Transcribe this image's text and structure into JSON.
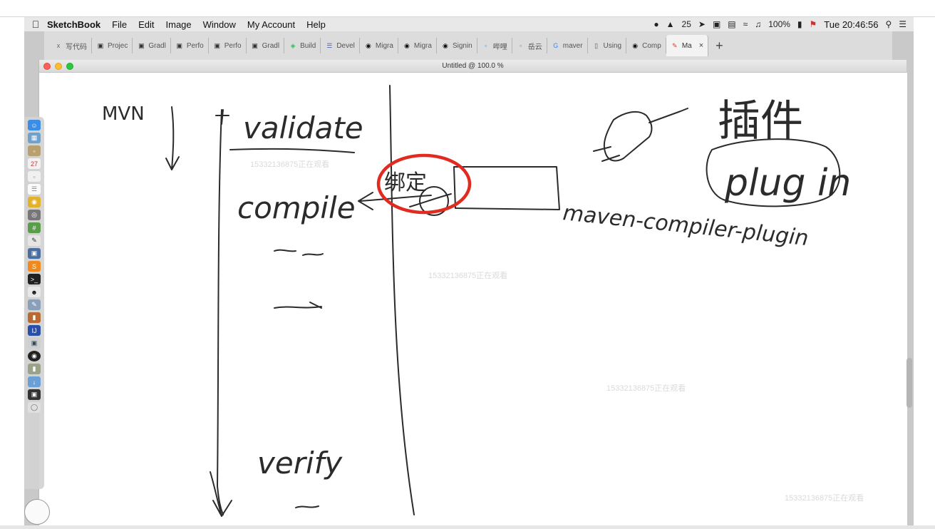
{
  "menubar": {
    "app_name": "SketchBook",
    "items": [
      "File",
      "Edit",
      "Image",
      "Window",
      "My Account",
      "Help"
    ],
    "status": {
      "notification_count": "25",
      "battery": "100%",
      "clock": "Tue 20:46:56"
    }
  },
  "browser": {
    "tabs": [
      {
        "label": "写代码",
        "icon": "xml-icon"
      },
      {
        "label": "Projec",
        "icon": "document-icon"
      },
      {
        "label": "Gradl",
        "icon": "document-icon"
      },
      {
        "label": "Perfo",
        "icon": "document-icon"
      },
      {
        "label": "Perfo",
        "icon": "document-icon"
      },
      {
        "label": "Gradl",
        "icon": "document-icon"
      },
      {
        "label": "Build",
        "icon": "elephant-icon"
      },
      {
        "label": "Devel",
        "icon": "list-icon"
      },
      {
        "label": "Migra",
        "icon": "github-icon"
      },
      {
        "label": "Migra",
        "icon": "github-icon"
      },
      {
        "label": "Signin",
        "icon": "github-icon"
      },
      {
        "label": "哔哩",
        "icon": "bilibili-icon"
      },
      {
        "label": "岳云",
        "icon": "bilibili-icon"
      },
      {
        "label": "maver",
        "icon": "google-icon"
      },
      {
        "label": "Using",
        "icon": "book-icon"
      },
      {
        "label": "Comp",
        "icon": "github-icon"
      },
      {
        "label": "Ma",
        "icon": "pencil-icon",
        "active": true
      }
    ],
    "new_tab": "+"
  },
  "window": {
    "title": "Untitled @ 100.0 %"
  },
  "watermark_text": "15332136875正在观看",
  "sketch": {
    "lifecycle_label": "MVN",
    "phases": [
      "validate",
      "compile",
      "verify"
    ],
    "binding_label": "绑定",
    "plugin_cn": "插件",
    "plugin_en": "plug in",
    "plugin_name": "maven-compiler-plugin"
  },
  "colors": {
    "ink": "#2b2b2b",
    "highlight": "#e02b20"
  }
}
